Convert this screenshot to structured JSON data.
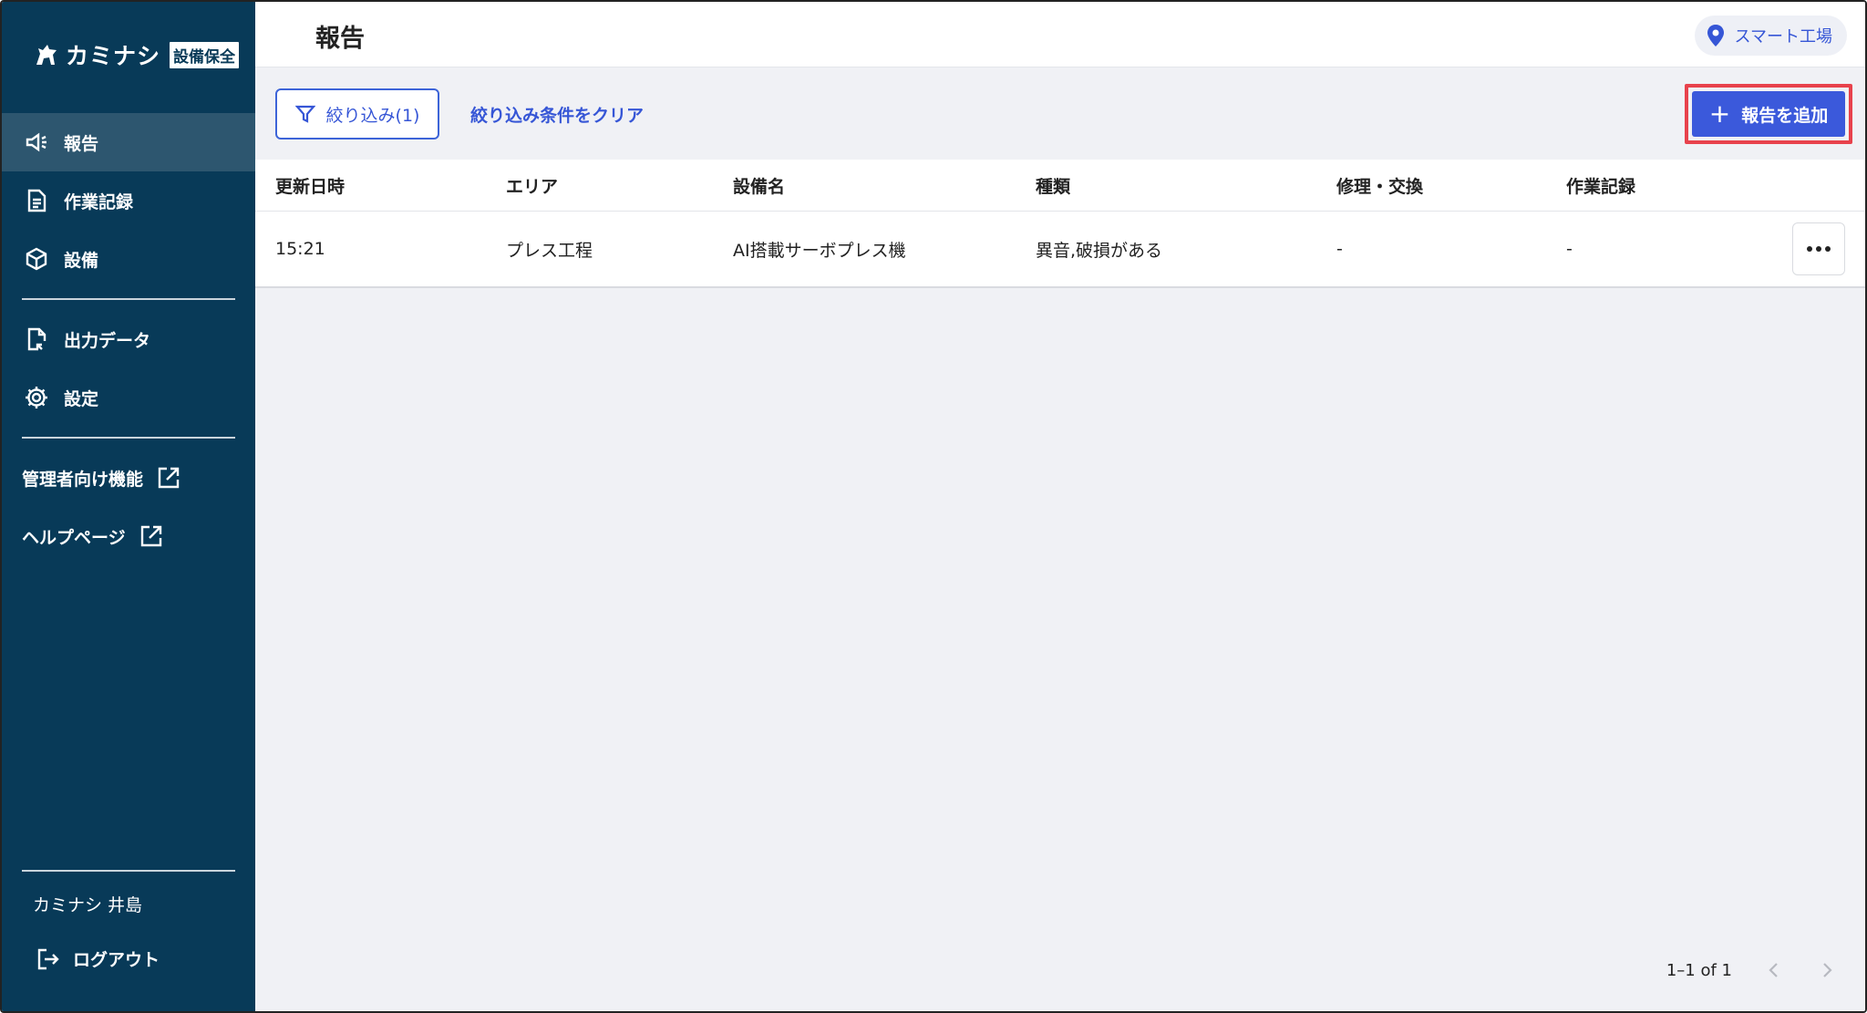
{
  "app": {
    "brand": "カミナシ",
    "badge": "設備保全"
  },
  "sidebar": {
    "items": [
      {
        "label": "報告",
        "icon": "megaphone-icon",
        "active": true
      },
      {
        "label": "作業記録",
        "icon": "document-icon"
      },
      {
        "label": "設備",
        "icon": "cube-icon"
      },
      {
        "label": "出力データ",
        "icon": "file-export-icon"
      },
      {
        "label": "設定",
        "icon": "gear-icon"
      }
    ],
    "external_links": [
      {
        "label": "管理者向け機能",
        "icon": "external-link-icon"
      },
      {
        "label": "ヘルプページ",
        "icon": "external-link-icon"
      }
    ],
    "user_name": "カミナシ 井島",
    "logout_label": "ログアウト"
  },
  "header": {
    "title": "報告",
    "location": "スマート工場"
  },
  "toolbar": {
    "filter_label": "絞り込み(1)",
    "clear_label": "絞り込み条件をクリア",
    "add_label": "報告を追加"
  },
  "table": {
    "columns": [
      "更新日時",
      "エリア",
      "設備名",
      "種類",
      "修理・交換",
      "作業記録"
    ],
    "rows": [
      [
        "15:21",
        "プレス工程",
        "AI搭載サーボプレス機",
        "異音,破損がある",
        "-",
        "-"
      ]
    ]
  },
  "pagination": {
    "range": "1–1 of 1"
  },
  "colors": {
    "sidebar_bg": "#083a58",
    "accent": "#3b59db",
    "highlight": "#e8424c"
  }
}
